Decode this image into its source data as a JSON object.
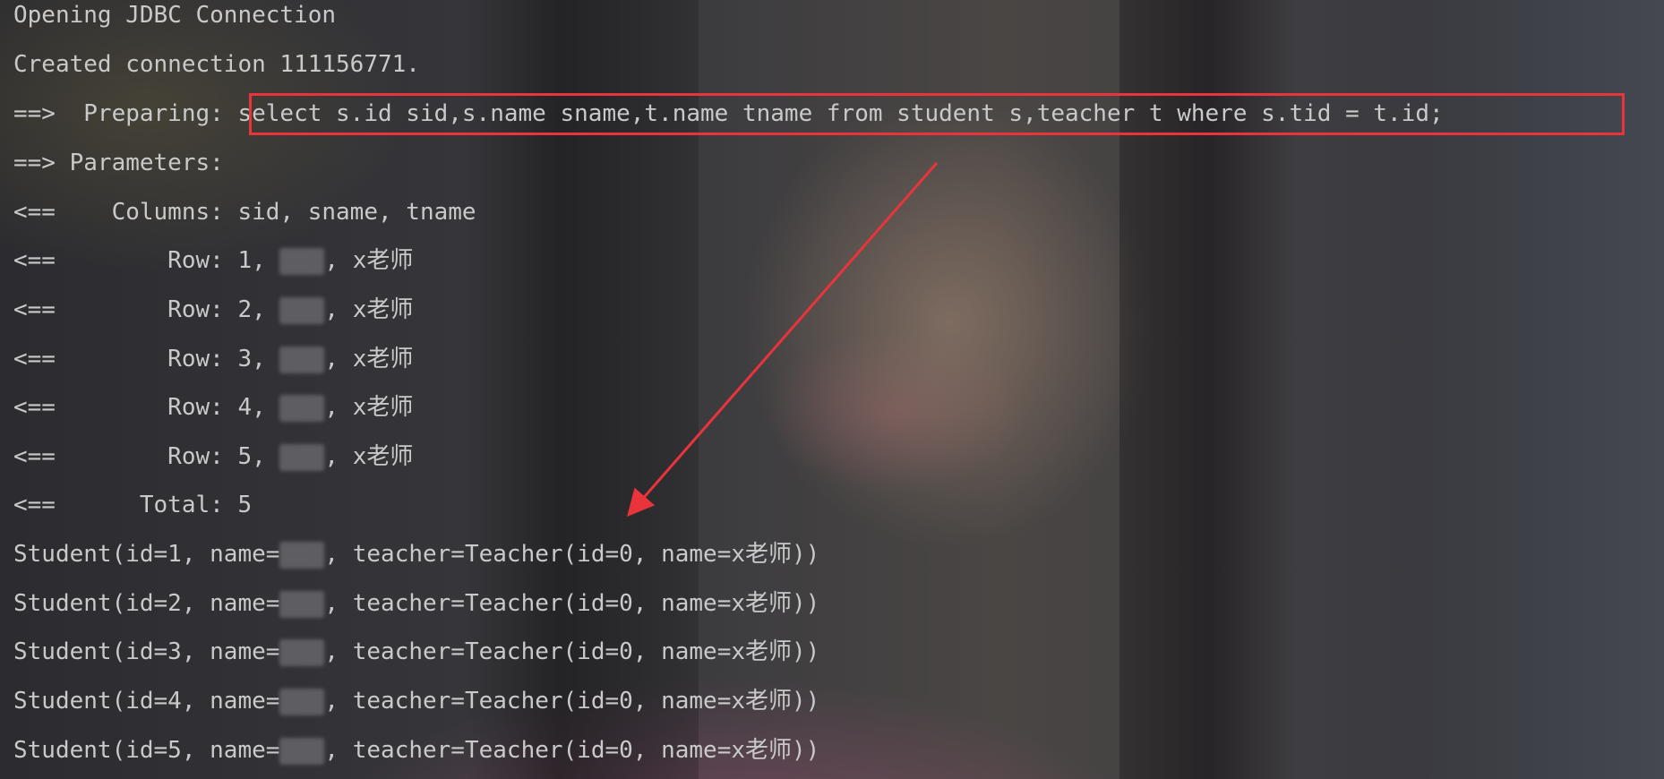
{
  "console": {
    "lines": [
      {
        "text": "Opening JDBC Connection"
      },
      {
        "text": "Created connection 111156771."
      },
      {
        "prefix": "==>  Preparing: ",
        "sql": "select s.id sid,s.name sname,t.name tname from student s,teacher t where s.tid = t.id;"
      },
      {
        "text": "==> Parameters: "
      },
      {
        "text": "<==    Columns: sid, sname, tname"
      },
      {
        "pre": "<==        Row: 1, ",
        "post": ", x老师"
      },
      {
        "pre": "<==        Row: 2, ",
        "post": ", x老师"
      },
      {
        "pre": "<==        Row: 3, ",
        "post": ", x老师"
      },
      {
        "pre": "<==        Row: 4, ",
        "post": ", x老师"
      },
      {
        "pre": "<==        Row: 5, ",
        "post": ", x老师"
      },
      {
        "text": "<==      Total: 5"
      },
      {
        "pre": "Student(id=1, name=",
        "post": ", teacher=Teacher(id=0, name=x老师))"
      },
      {
        "pre": "Student(id=2, name=",
        "post": ", teacher=Teacher(id=0, name=x老师))"
      },
      {
        "pre": "Student(id=3, name=",
        "post": ", teacher=Teacher(id=0, name=x老师))"
      },
      {
        "pre": "Student(id=4, name=",
        "post": ", teacher=Teacher(id=0, name=x老师))"
      },
      {
        "pre": "Student(id=5, name=",
        "post": ", teacher=Teacher(id=0, name=x老师))"
      }
    ]
  },
  "annotation": {
    "color": "#e8343a"
  }
}
